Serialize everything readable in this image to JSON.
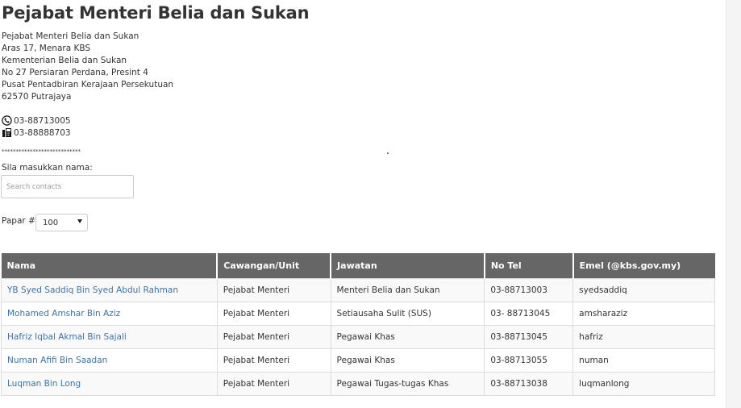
{
  "page": {
    "title": "Pejabat Menteri Belia dan Sukan",
    "address": [
      "Pejabat Menteri Belia dan Sukan",
      "Aras 17, Menara KBS",
      "Kementerian Belia dan Sukan",
      "No 27 Persiaran Perdana, Presint 4",
      "Pusat Pentadbiran Kerajaan Persekutuan",
      "62570 Putrajaya"
    ],
    "phone": "03-88713005",
    "fax": "03-88888703",
    "stars": "****************************",
    "icons": {
      "phone": "phone-icon",
      "fax": "fax-icon"
    }
  },
  "search": {
    "label": "Sila masukkan nama:",
    "placeholder": "Search contacts",
    "value": ""
  },
  "papar": {
    "label": "Papar #",
    "selected": "100"
  },
  "table": {
    "headers": [
      "Nama",
      "Cawangan/Unit",
      "Jawatan",
      "No Tel",
      "Emel (@kbs.gov.my)"
    ],
    "rows": [
      {
        "nama": "YB Syed Saddiq Bin Syed Abdul Rahman",
        "unit": "Pejabat Menteri",
        "jawatan": "Menteri Belia dan Sukan",
        "tel": "03-88713003",
        "emel": "syedsaddiq"
      },
      {
        "nama": "Mohamed Amshar Bin Aziz",
        "unit": "Pejabat Menteri",
        "jawatan": "Setiausaha Sulit (SUS)",
        "tel": "03- 88713045",
        "emel": "amsharaziz"
      },
      {
        "nama": "Hafriz Iqbal Akmal Bin Sajali",
        "unit": "Pejabat Menteri",
        "jawatan": "Pegawai Khas",
        "tel": "03-88713045",
        "emel": "hafriz"
      },
      {
        "nama": "Numan Afifi Bin Saadan",
        "unit": "Pejabat Menteri",
        "jawatan": "Pegawai Khas",
        "tel": "03-88713055",
        "emel": "numan"
      },
      {
        "nama": "Luqman Bin Long",
        "unit": "Pejabat Menteri",
        "jawatan": "Pegawai Tugas-tugas Khas",
        "tel": "03-88713038",
        "emel": "luqmanlong"
      }
    ]
  },
  "colors": {
    "header_bg": "#666666",
    "link": "#3a74ad",
    "row_alt": "#f9f9f9"
  }
}
